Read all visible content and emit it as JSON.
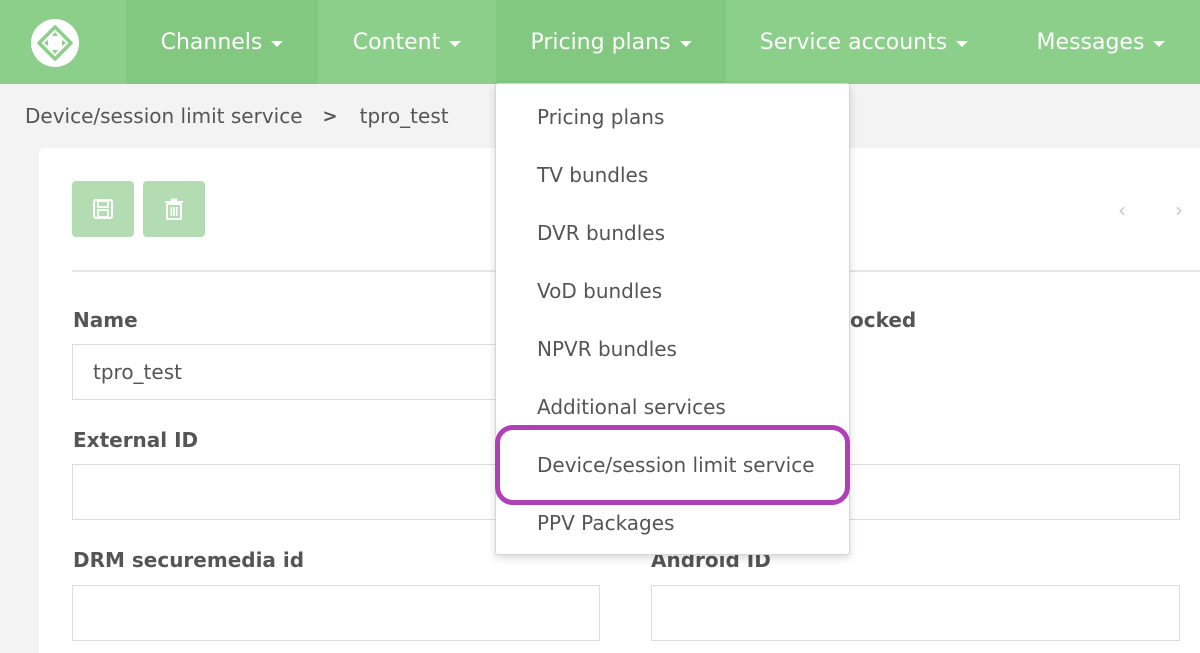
{
  "nav": {
    "items": [
      {
        "label": "Channels"
      },
      {
        "label": "Content"
      },
      {
        "label": "Pricing plans"
      },
      {
        "label": "Service accounts"
      },
      {
        "label": "Messages"
      }
    ]
  },
  "breadcrumb": {
    "parent": "Device/session limit service",
    "separator": ">",
    "current": "tpro_test"
  },
  "toolbar": {
    "save_icon": "save-icon",
    "delete_icon": "trash-icon",
    "prev": "‹",
    "next": "›"
  },
  "form": {
    "name_label": "Name",
    "name_value": "tpro_test",
    "blocked_label_partial": "ocked",
    "external_id_label": "External ID",
    "external_id_value": "",
    "drm_label": "DRM securemedia id",
    "drm_value": "",
    "android_label": "Android ID",
    "android_value": ""
  },
  "dropdown": {
    "items": [
      {
        "label": "Pricing plans"
      },
      {
        "label": "TV bundles"
      },
      {
        "label": "DVR bundles"
      },
      {
        "label": "VoD bundles"
      },
      {
        "label": "NPVR bundles"
      },
      {
        "label": "Additional services"
      },
      {
        "label": "Device/session limit service"
      },
      {
        "label": "PPV Packages"
      }
    ]
  },
  "colors": {
    "navbar": "#8ccf8a",
    "button": "#b3dcb2",
    "highlight": "#b040b8"
  }
}
